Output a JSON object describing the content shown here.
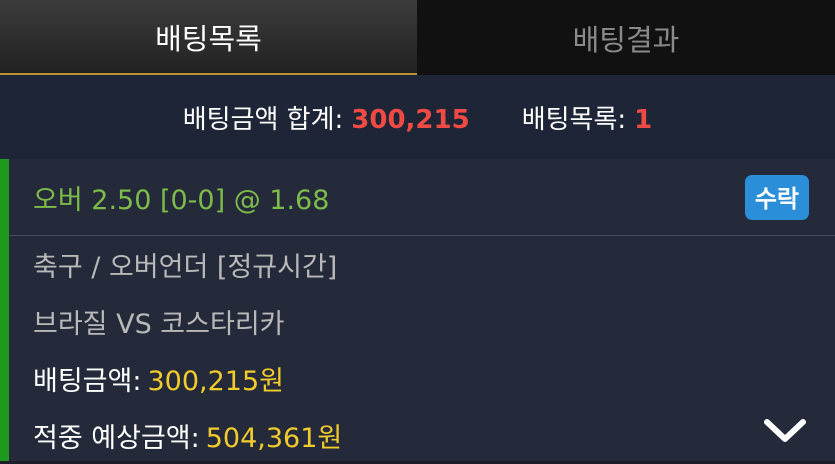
{
  "tabs": [
    {
      "label": "배팅목록",
      "active": true
    },
    {
      "label": "배팅결과",
      "active": false
    }
  ],
  "summary": {
    "total_label": "배팅금액 합계:",
    "total_value": "300,215",
    "count_label": "배팅목록:",
    "count_value": "1"
  },
  "bet": {
    "pick": "오버 2.50 [0-0] @ 1.68",
    "status": "수락",
    "market": "축구 / 오버언더 [정규시간]",
    "match": "브라질 VS 코스타리카",
    "amount_label": "배팅금액:",
    "amount_value": "300,215원",
    "payout_label": "적중 예상금액:",
    "payout_value": "504,361원"
  },
  "colors": {
    "accent_gold": "#b8932f",
    "red_value": "#ef4a43",
    "yellow_value": "#f1cc2c",
    "pick_green": "#7dbb4a",
    "badge_blue": "#2a8fd8",
    "card_stripe": "#1d9a1d"
  },
  "icons": {
    "expand": "chevron-down-icon"
  }
}
